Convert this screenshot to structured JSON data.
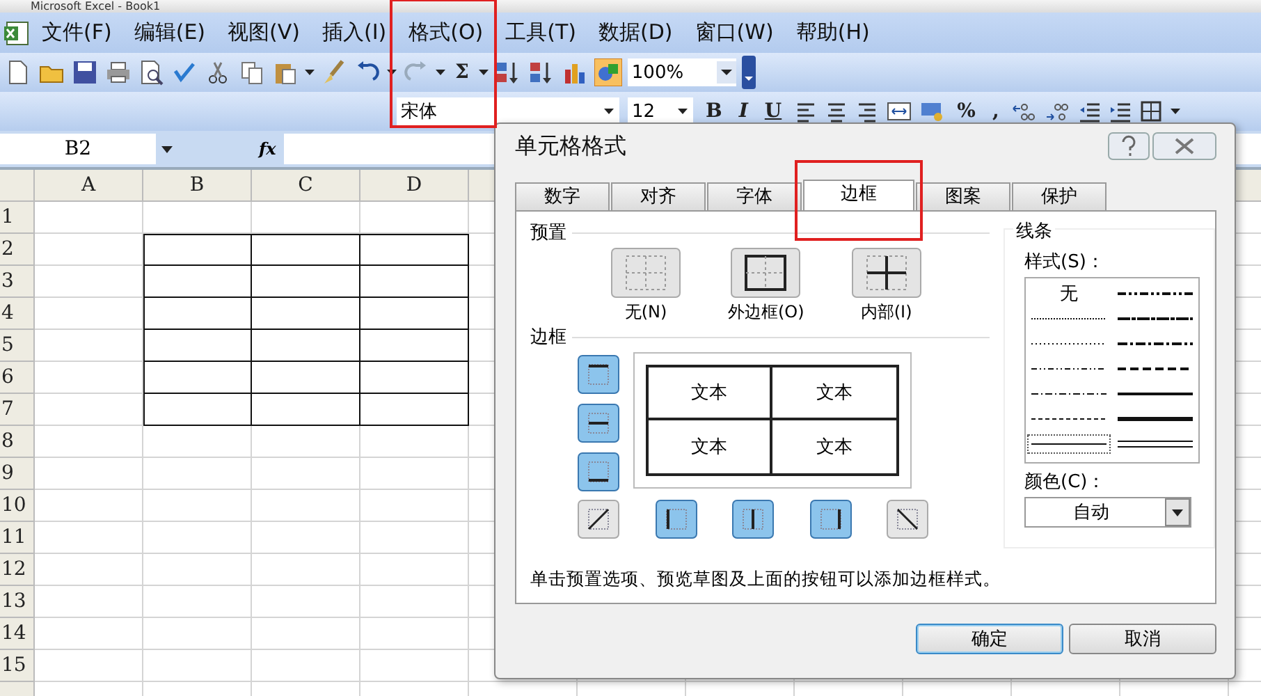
{
  "window": {
    "title": "Microsoft Excel - Book1"
  },
  "menu": [
    {
      "label": "文件(F)",
      "highlighted": false
    },
    {
      "label": "编辑(E)",
      "highlighted": false
    },
    {
      "label": "视图(V)",
      "highlighted": false
    },
    {
      "label": "插入(I)",
      "highlighted": false
    },
    {
      "label": "格式(O)",
      "highlighted": true
    },
    {
      "label": "工具(T)",
      "highlighted": false
    },
    {
      "label": "数据(D)",
      "highlighted": false
    },
    {
      "label": "窗口(W)",
      "highlighted": false
    },
    {
      "label": "帮助(H)",
      "highlighted": false
    }
  ],
  "standard_toolbar": {
    "sum": "Σ",
    "zoom": "100%"
  },
  "formatting_toolbar": {
    "font": "宋体",
    "size": "12",
    "bold": "B",
    "italic": "I",
    "underline": "U",
    "percent": "%",
    "comma": ","
  },
  "formula_bar": {
    "name_box": "B2",
    "fx": "fx"
  },
  "sheet": {
    "columns": [
      {
        "label": "A",
        "bordered": false
      },
      {
        "label": "B",
        "bordered": true
      },
      {
        "label": "C",
        "bordered": true
      },
      {
        "label": "D",
        "bordered": true
      }
    ],
    "rows": [
      {
        "label": "1",
        "bordered": false
      },
      {
        "label": "2",
        "bordered": true
      },
      {
        "label": "3",
        "bordered": true
      },
      {
        "label": "4",
        "bordered": true
      },
      {
        "label": "5",
        "bordered": true
      },
      {
        "label": "6",
        "bordered": true
      },
      {
        "label": "7",
        "bordered": true
      },
      {
        "label": "8",
        "bordered": false
      },
      {
        "label": "9",
        "bordered": false
      },
      {
        "label": "10",
        "bordered": false
      },
      {
        "label": "11",
        "bordered": false
      },
      {
        "label": "12",
        "bordered": false
      },
      {
        "label": "13",
        "bordered": false
      },
      {
        "label": "14",
        "bordered": false
      },
      {
        "label": "15",
        "bordered": false
      }
    ]
  },
  "dialog": {
    "title": "单元格格式",
    "tabs": [
      {
        "label": "数字",
        "selected": false,
        "highlighted": false
      },
      {
        "label": "对齐",
        "selected": false,
        "highlighted": false
      },
      {
        "label": "字体",
        "selected": false,
        "highlighted": false
      },
      {
        "label": "边框",
        "selected": true,
        "highlighted": true
      },
      {
        "label": "图案",
        "selected": false,
        "highlighted": false
      },
      {
        "label": "保护",
        "selected": false,
        "highlighted": false
      }
    ],
    "presets": {
      "label": "预置",
      "items": [
        {
          "label": "无(N)",
          "kind": "none"
        },
        {
          "label": "外边框(O)",
          "kind": "outline"
        },
        {
          "label": "内部(I)",
          "kind": "inside"
        }
      ]
    },
    "border": {
      "label": "边框",
      "side_buttons": [
        {
          "kind": "top",
          "on": true
        },
        {
          "kind": "inner-horizontal",
          "on": true
        },
        {
          "kind": "bottom",
          "on": true
        }
      ],
      "bottom_buttons": [
        {
          "kind": "diagonal-up",
          "on": false
        },
        {
          "kind": "left",
          "on": true
        },
        {
          "kind": "inner-vertical",
          "on": true
        },
        {
          "kind": "right",
          "on": true
        },
        {
          "kind": "diagonal-down",
          "on": false
        }
      ],
      "preview_cells": [
        "文本",
        "文本",
        "文本",
        "文本"
      ]
    },
    "hint": "单击预置选项、预览草图及上面的按钮可以添加边框样式。",
    "line": {
      "label": "线条",
      "style_label": "样式(S)：",
      "styles": [
        {
          "kind": "none",
          "label": "无",
          "selected": false
        },
        {
          "kind": "hair",
          "selected": false
        },
        {
          "kind": "dotted",
          "selected": false
        },
        {
          "kind": "dash-dot-dot",
          "selected": false
        },
        {
          "kind": "dash-dot",
          "selected": false
        },
        {
          "kind": "dashed",
          "selected": false
        },
        {
          "kind": "thin",
          "selected": true
        },
        {
          "kind": "medium-dash-dot-dot",
          "selected": false
        },
        {
          "kind": "slanted-dash-dot",
          "selected": false
        },
        {
          "kind": "medium-dash-dot",
          "selected": false
        },
        {
          "kind": "medium-dashed",
          "selected": false
        },
        {
          "kind": "medium",
          "selected": false
        },
        {
          "kind": "thick",
          "selected": false
        },
        {
          "kind": "double",
          "selected": false
        }
      ],
      "color_label": "颜色(C)：",
      "color_choice": "自动"
    },
    "buttons": [
      {
        "label": "确定",
        "default": true
      },
      {
        "label": "取消",
        "default": false
      }
    ]
  }
}
